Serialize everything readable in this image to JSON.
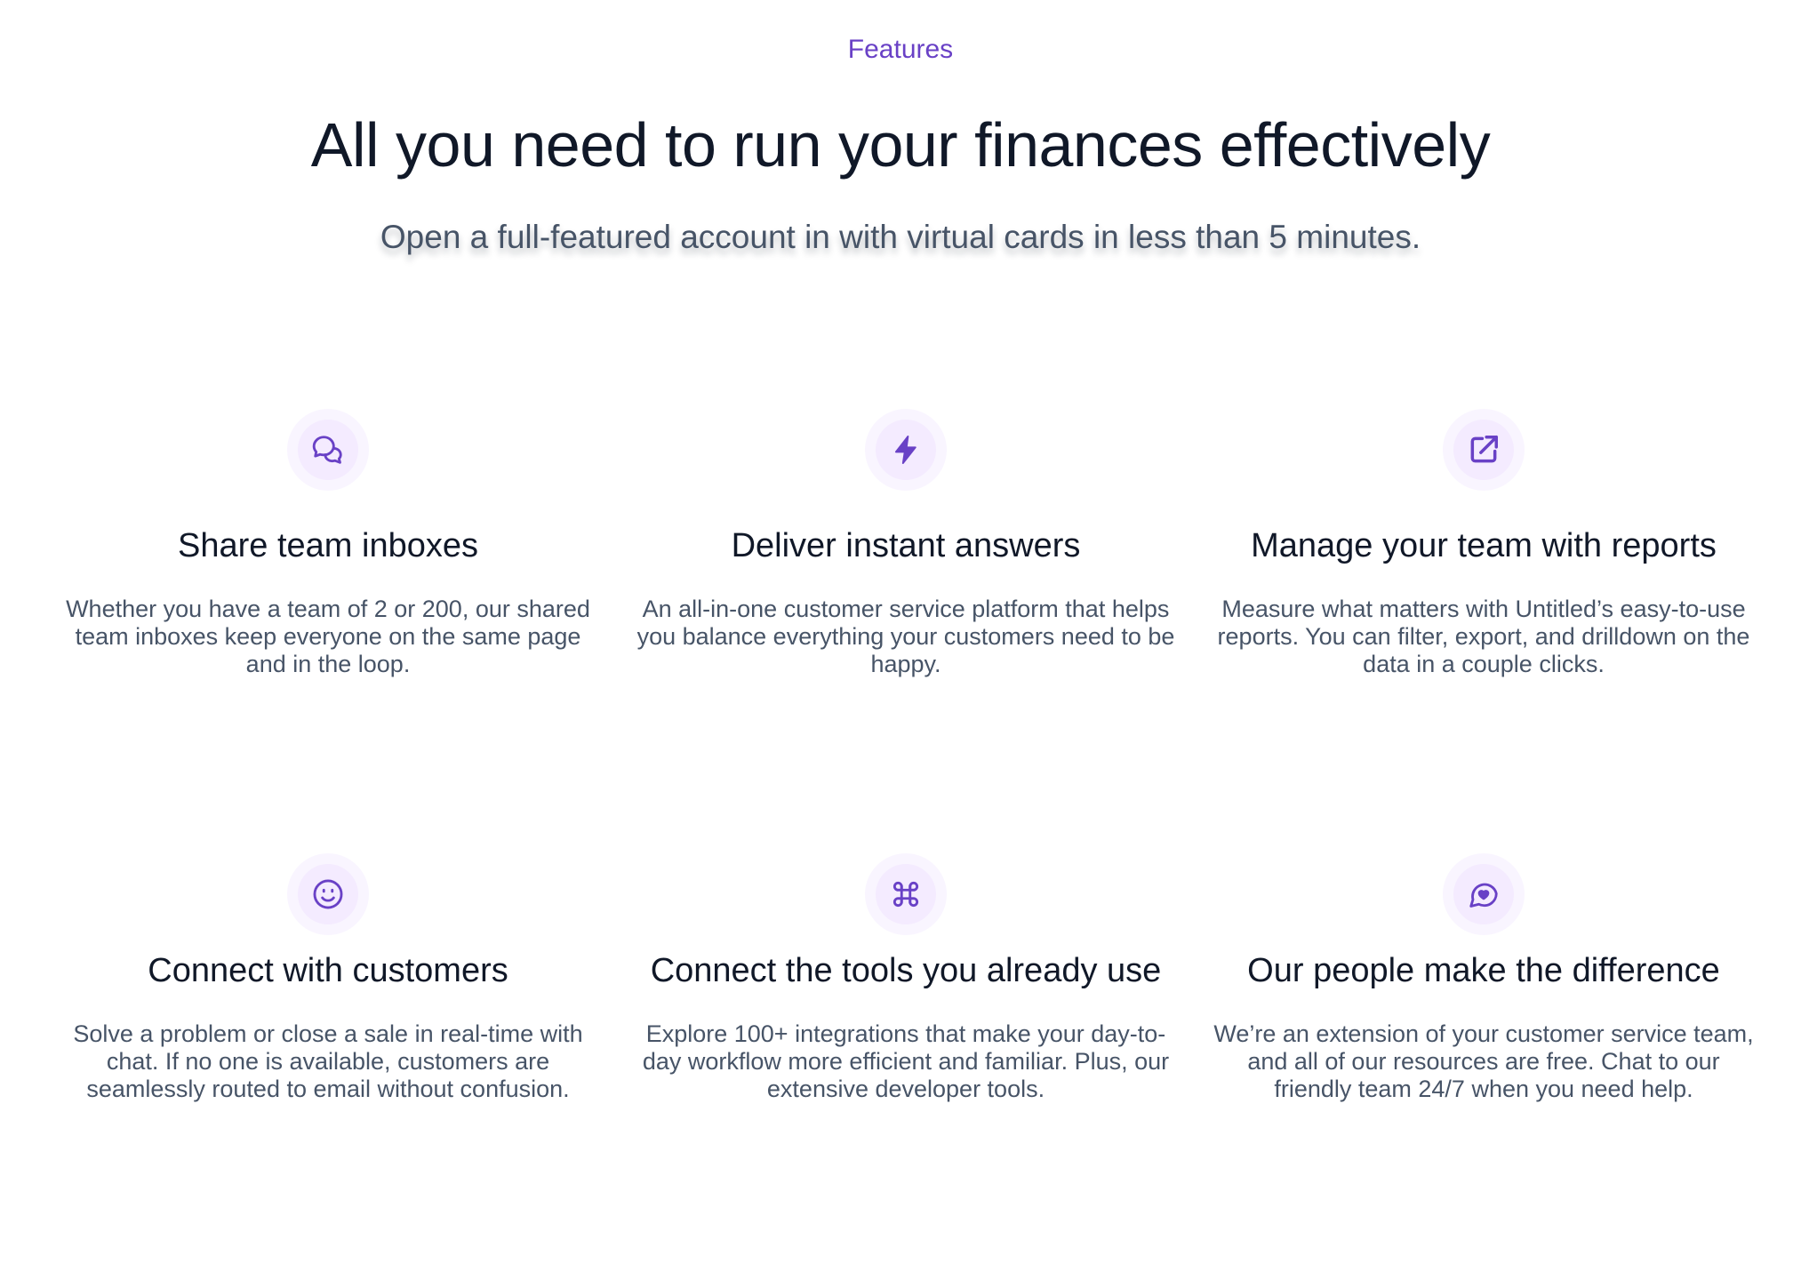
{
  "header": {
    "eyebrow": "Features",
    "title": "All you need to run your finances effectively",
    "subtitle": "Open a full-featured account in with virtual cards in less than 5 minutes."
  },
  "colors": {
    "accent": "#6941c6",
    "icon_ring_outer": "#f9f5ff",
    "icon_ring_inner": "#f4ebff",
    "heading": "#101828",
    "body_text": "#475467"
  },
  "features": [
    {
      "icon": "message-chat-icon",
      "title": "Share team inboxes",
      "description": "Whether you have a team of 2 or 200, our shared team inboxes keep everyone on the same page and in the loop."
    },
    {
      "icon": "zap-icon",
      "title": "Deliver instant answers",
      "description": "An all-in-one customer service platform that helps you balance everything your customers need to be happy."
    },
    {
      "icon": "external-link-icon",
      "title": "Manage your team with reports",
      "description": "Measure what matters with Untitled’s easy-to-use reports. You can filter, export, and drilldown on the data in a couple clicks."
    },
    {
      "icon": "smile-icon",
      "title": "Connect with customers",
      "description": "Solve a problem or close a sale in real-time with chat. If no one is available, customers are seamlessly routed to email without confusion."
    },
    {
      "icon": "command-icon",
      "title": "Connect the tools you already use",
      "description": "Explore 100+ integrations that make your day-to-day workflow more efficient and familiar. Plus, our extensive developer tools."
    },
    {
      "icon": "message-heart-icon",
      "title": "Our people make the difference",
      "description": "We’re an extension of your customer service team, and all of our resources are free. Chat to our friendly team 24/7 when you need help."
    }
  ]
}
